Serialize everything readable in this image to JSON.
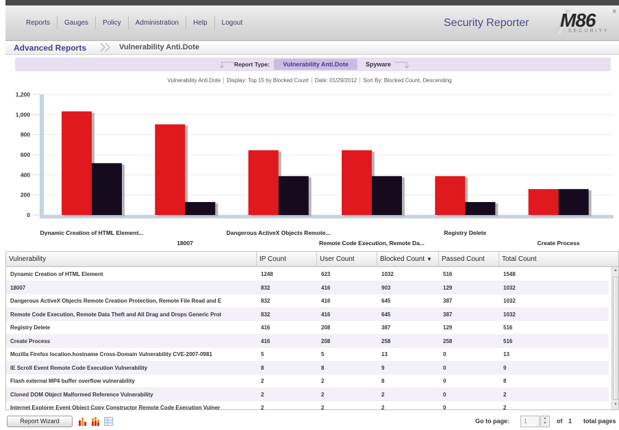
{
  "nav": [
    "Reports",
    "Gauges",
    "Policy",
    "Administration",
    "Help",
    "Logout"
  ],
  "app_title": "Security Reporter",
  "logo": {
    "main": "M86",
    "sub": "SECURITY",
    "reg": "®"
  },
  "breadcrumb": {
    "root": "Advanced Reports",
    "current": "Vulnerability Anti.Dote"
  },
  "report_type": {
    "label": "Report Type:",
    "active": "Vulnerability Anti.Dote",
    "other": "Spyware"
  },
  "summary": [
    "Vulnerability Anti.Dote",
    "Display: Top 15 by Blocked Count",
    "Date: 01/29/2012",
    "Sort By: Blocked Count, Descending"
  ],
  "chart_data": {
    "type": "bar",
    "categories": [
      "Dynamic Creation of HTML Element...",
      "18007",
      "Dangerous ActiveX Objects Remote...",
      "Remote Code Execution, Remote Da...",
      "Registry Delete",
      "Create Process"
    ],
    "series": [
      {
        "values": [
          1032,
          903,
          645,
          645,
          387,
          258
        ],
        "color": "#e0191f"
      },
      {
        "values": [
          516,
          129,
          387,
          387,
          129,
          258
        ],
        "color": "#160a1e"
      }
    ],
    "yticks": [
      "0",
      "200",
      "400",
      "600",
      "800",
      "1,000",
      "1,200"
    ],
    "ylim": [
      0,
      1200
    ],
    "grid": true
  },
  "table": {
    "columns": [
      "Vulnerability",
      "IP Count",
      "User Count",
      "Blocked Count",
      "Passed Count",
      "Total Count"
    ],
    "sort_indicator": "▼",
    "rows": [
      [
        "Dynamic Creation of HTML Element",
        "1248",
        "623",
        "1032",
        "516",
        "1548"
      ],
      [
        "18007",
        "832",
        "416",
        "903",
        "129",
        "1032"
      ],
      [
        "Dangerous ActiveX Objects Remote Creation Protection, Remote File Read and E",
        "832",
        "416",
        "645",
        "387",
        "1032"
      ],
      [
        "Remote Code Execution, Remote Data Theft and All Drag and Drops Generic Prot",
        "832",
        "416",
        "645",
        "387",
        "1032"
      ],
      [
        "Registry Delete",
        "416",
        "208",
        "387",
        "129",
        "516"
      ],
      [
        "Create Process",
        "416",
        "208",
        "258",
        "258",
        "516"
      ],
      [
        "Mozilla Firefox location.hostname Cross-Domain Vulnerability CVE-2007-0981",
        "5",
        "5",
        "13",
        "0",
        "13"
      ],
      [
        "IE Scroll Event Remote Code Execution Vulnerability",
        "8",
        "8",
        "9",
        "0",
        "9"
      ],
      [
        "Flash external MP4 buffer overflow vulnerability",
        "2",
        "2",
        "8",
        "0",
        "8"
      ],
      [
        "Cloned DOM Object Malformed Reference Vulnerability",
        "2",
        "2",
        "2",
        "0",
        "2"
      ],
      [
        "Internet Explorer Event Object Copy Constructor Remote Code Execution Vulner",
        "2",
        "2",
        "2",
        "0",
        "2"
      ]
    ]
  },
  "footer": {
    "wizard": "Report Wizard",
    "goto": "Go to page:",
    "page": "1",
    "of": "of",
    "total": "1",
    "total_label": "total pages"
  },
  "icons": [
    "bar-chart-icon",
    "stacked-bar-icon",
    "table-view-icon"
  ]
}
